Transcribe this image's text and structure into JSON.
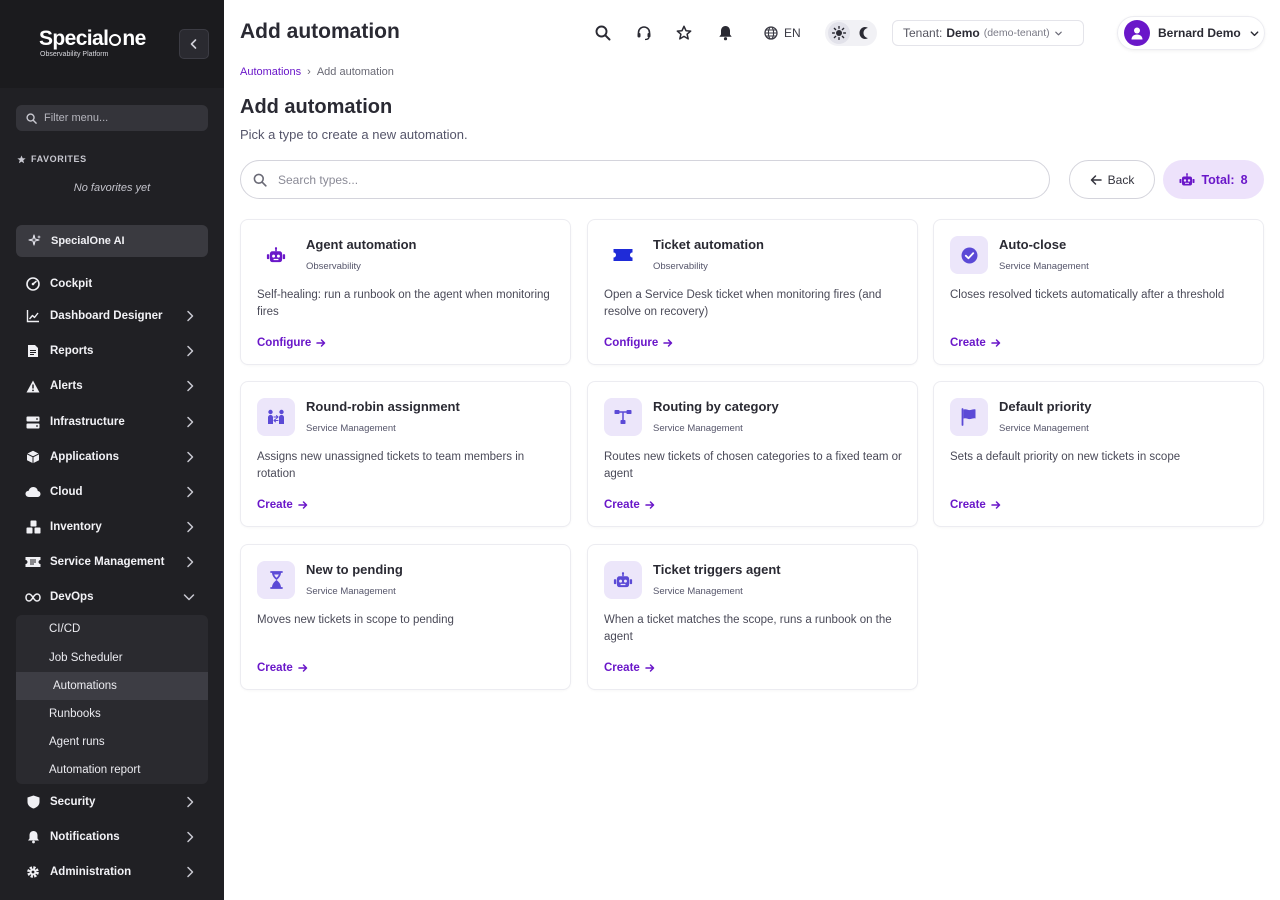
{
  "brand": {
    "name_before": "Special",
    "name_after": "ne",
    "tagline": "Observability Platform"
  },
  "sidebar": {
    "filter_placeholder": "Filter menu...",
    "favorites_heading": "FAVORITES",
    "favorites_empty": "No favorites yet",
    "ai_label": "SpecialOne AI",
    "items": [
      {
        "label": "Cockpit"
      },
      {
        "label": "Dashboard Designer"
      },
      {
        "label": "Reports"
      },
      {
        "label": "Alerts"
      },
      {
        "label": "Infrastructure"
      },
      {
        "label": "Applications"
      },
      {
        "label": "Cloud"
      },
      {
        "label": "Inventory"
      },
      {
        "label": "Service Management"
      },
      {
        "label": "DevOps"
      },
      {
        "label": "Security"
      },
      {
        "label": "Notifications"
      },
      {
        "label": "Administration"
      }
    ],
    "devops_sub": [
      {
        "label": "CI/CD"
      },
      {
        "label": "Job Scheduler"
      },
      {
        "label": "Automations"
      },
      {
        "label": "Runbooks"
      },
      {
        "label": "Agent runs"
      },
      {
        "label": "Automation report"
      }
    ]
  },
  "header": {
    "title": "Add automation",
    "language": "EN",
    "tenant_label": "Tenant:",
    "tenant_name": "Demo",
    "tenant_id": "(demo-tenant)",
    "user_name": "Bernard Demo"
  },
  "breadcrumb": {
    "parent": "Automations",
    "separator": "›",
    "current": "Add automation"
  },
  "page": {
    "title": "Add automation",
    "subtitle": "Pick a type to create a new automation.",
    "search_placeholder": "Search types...",
    "back_label": "Back",
    "total_label": "Total:",
    "total_count": "8"
  },
  "colors": {
    "accent": "#6a17c9",
    "accent_soft": "#ede2fb",
    "sidebar_bg": "#202024"
  },
  "cards": [
    {
      "title": "Agent automation",
      "category": "Observability",
      "description": "Self-healing: run a runbook on the agent when monitoring fires",
      "action": "Configure",
      "icon": "robot-icon"
    },
    {
      "title": "Ticket automation",
      "category": "Observability",
      "description": "Open a Service Desk ticket when monitoring fires (and resolve on recovery)",
      "action": "Configure",
      "icon": "ticket-icon"
    },
    {
      "title": "Auto-close",
      "category": "Service Management",
      "description": "Closes resolved tickets automatically after a threshold",
      "action": "Create",
      "icon": "check-circle-icon"
    },
    {
      "title": "Round-robin assignment",
      "category": "Service Management",
      "description": "Assigns new unassigned tickets to team members in rotation",
      "action": "Create",
      "icon": "people-exchange-icon"
    },
    {
      "title": "Routing by category",
      "category": "Service Management",
      "description": "Routes new tickets of chosen categories to a fixed team or agent",
      "action": "Create",
      "icon": "routing-icon"
    },
    {
      "title": "Default priority",
      "category": "Service Management",
      "description": "Sets a default priority on new tickets in scope",
      "action": "Create",
      "icon": "flag-icon"
    },
    {
      "title": "New to pending",
      "category": "Service Management",
      "description": "Moves new tickets in scope to pending",
      "action": "Create",
      "icon": "hourglass-icon"
    },
    {
      "title": "Ticket triggers agent",
      "category": "Service Management",
      "description": "When a ticket matches the scope, runs a runbook on the agent",
      "action": "Create",
      "icon": "robot-icon"
    }
  ]
}
